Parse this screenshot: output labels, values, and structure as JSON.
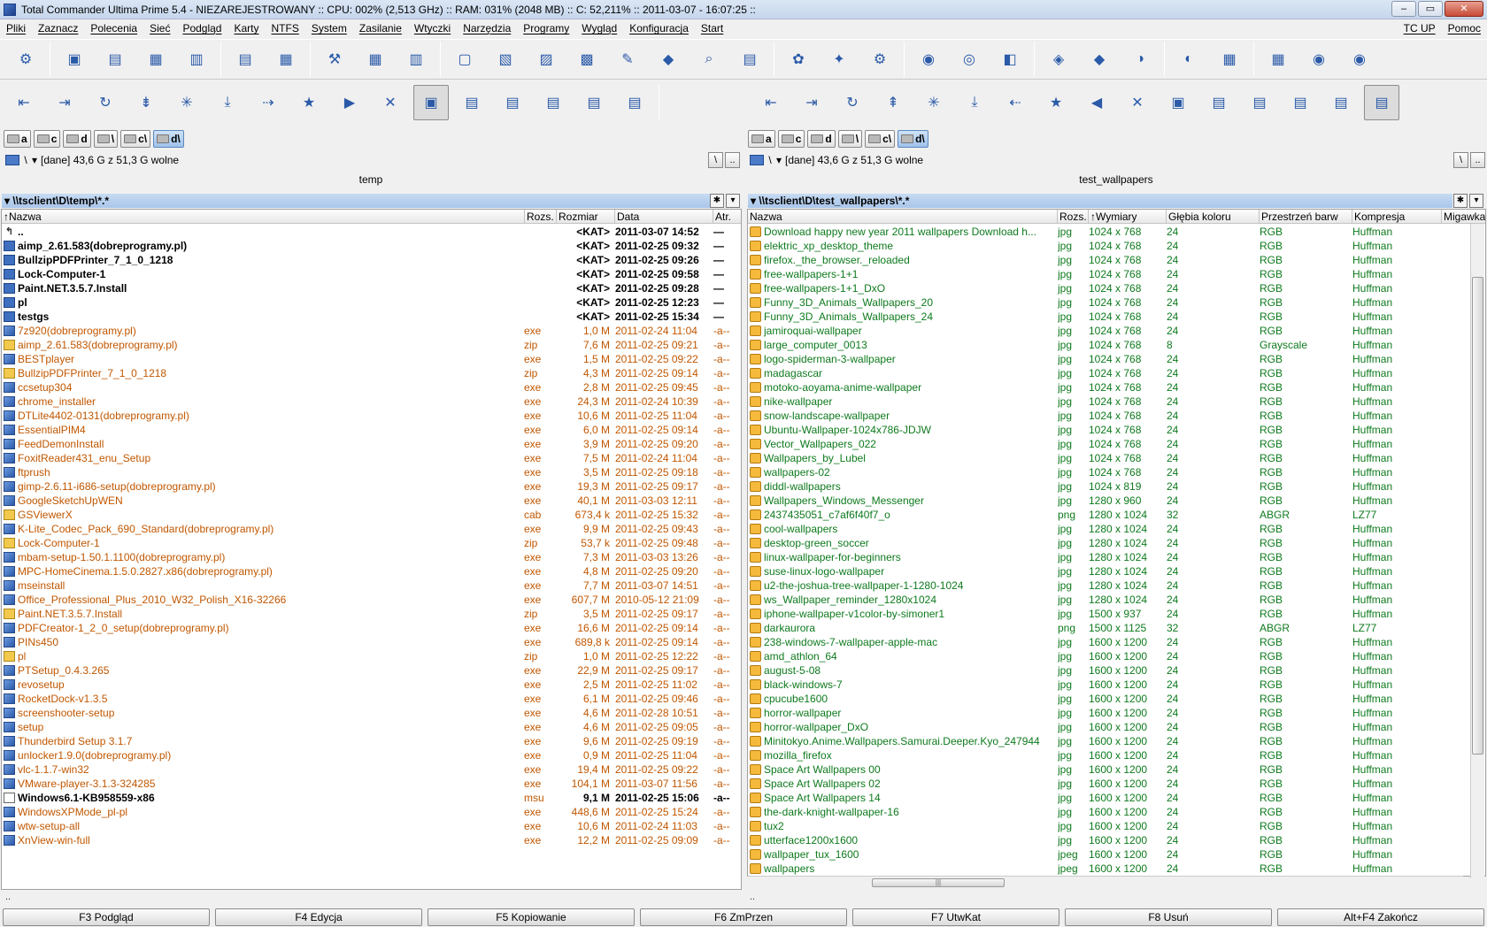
{
  "window": {
    "title": "Total Commander Ultima Prime 5.4 - NIEZAREJESTROWANY :: CPU: 002% (2,513 GHz) :: RAM: 031% (2048 MB) :: C: 52,211% :: 2011-03-07 - 16:07:25 ::",
    "minimize": "–",
    "maximize": "▭",
    "close": "✕"
  },
  "menu": {
    "items": [
      "Pliki",
      "Zaznacz",
      "Polecenia",
      "Sieć",
      "Podgląd",
      "Karty",
      "NTFS",
      "System",
      "Zasilanie",
      "Wtyczki",
      "Narzędzia",
      "Programy",
      "Wygląd",
      "Konfiguracja",
      "Start"
    ],
    "right": [
      "TC UP",
      "Pomoc"
    ]
  },
  "toolbar": {
    "icons": [
      "⚙",
      "▣",
      "▤",
      "▦",
      "▥",
      "▤",
      "▦",
      "⚒",
      "▦",
      "▥",
      "▢",
      "▧",
      "▨",
      "▩",
      "✎",
      "◆",
      "⌕",
      "▤",
      "✿",
      "✦",
      "⚙",
      "◉",
      "◎",
      "◧",
      "◈",
      "◆",
      "◑",
      "◐",
      "▦",
      "▦",
      "◉",
      "◉"
    ]
  },
  "left": {
    "nav_icons": [
      "⇤",
      "⇥",
      "↻",
      "⇟",
      "✳",
      "⤓",
      "⇢",
      "★",
      "▶",
      "✕",
      "▣",
      "▤",
      "▤",
      "▤",
      "▤",
      "▤"
    ],
    "drives": [
      "a",
      "c",
      "d",
      "\\",
      "c\\",
      "d\\"
    ],
    "path_combo": "\\",
    "free_space": "[dane]  43,6 G z 51,3 G wolne",
    "root_btn": "\\",
    "up_btn": "..",
    "title": "temp",
    "path": "\\\\tsclient\\D\\temp\\*.*",
    "columns": {
      "name": "Nazwa",
      "ext": "Rozs.",
      "size": "Rozmiar",
      "date": "Data",
      "attr": "Atr."
    },
    "files": [
      {
        "name": "..",
        "ext": "",
        "size": "<KAT>",
        "date": "2011-03-07 14:52",
        "attr": "—",
        "type": "up"
      },
      {
        "name": "aimp_2.61.583(dobreprogramy.pl)",
        "ext": "",
        "size": "<KAT>",
        "date": "2011-02-25 09:32",
        "attr": "—",
        "type": "dir"
      },
      {
        "name": "BullzipPDFPrinter_7_1_0_1218",
        "ext": "",
        "size": "<KAT>",
        "date": "2011-02-25 09:26",
        "attr": "—",
        "type": "dir"
      },
      {
        "name": "Lock-Computer-1",
        "ext": "",
        "size": "<KAT>",
        "date": "2011-02-25 09:58",
        "attr": "—",
        "type": "dir"
      },
      {
        "name": "Paint.NET.3.5.7.Install",
        "ext": "",
        "size": "<KAT>",
        "date": "2011-02-25 09:28",
        "attr": "—",
        "type": "dir"
      },
      {
        "name": "pl",
        "ext": "",
        "size": "<KAT>",
        "date": "2011-02-25 12:23",
        "attr": "—",
        "type": "dir"
      },
      {
        "name": "testgs",
        "ext": "",
        "size": "<KAT>",
        "date": "2011-02-25 15:34",
        "attr": "—",
        "type": "dir"
      },
      {
        "name": "7z920(dobreprogramy.pl)",
        "ext": "exe",
        "size": "1,0 M",
        "date": "2011-02-24 11:04",
        "attr": "-a--",
        "type": "exe"
      },
      {
        "name": "aimp_2.61.583(dobreprogramy.pl)",
        "ext": "zip",
        "size": "7,6 M",
        "date": "2011-02-25 09:21",
        "attr": "-a--",
        "type": "zip"
      },
      {
        "name": "BESTplayer",
        "ext": "exe",
        "size": "1,5 M",
        "date": "2011-02-25 09:22",
        "attr": "-a--",
        "type": "exe"
      },
      {
        "name": "BullzipPDFPrinter_7_1_0_1218",
        "ext": "zip",
        "size": "4,3 M",
        "date": "2011-02-25 09:14",
        "attr": "-a--",
        "type": "zip"
      },
      {
        "name": "ccsetup304",
        "ext": "exe",
        "size": "2,8 M",
        "date": "2011-02-25 09:45",
        "attr": "-a--",
        "type": "exe"
      },
      {
        "name": "chrome_installer",
        "ext": "exe",
        "size": "24,3 M",
        "date": "2011-02-24 10:39",
        "attr": "-a--",
        "type": "exe"
      },
      {
        "name": "DTLite4402-0131(dobreprogramy.pl)",
        "ext": "exe",
        "size": "10,6 M",
        "date": "2011-02-25 11:04",
        "attr": "-a--",
        "type": "exe"
      },
      {
        "name": "EssentialPIM4",
        "ext": "exe",
        "size": "6,0 M",
        "date": "2011-02-25 09:14",
        "attr": "-a--",
        "type": "exe"
      },
      {
        "name": "FeedDemonInstall",
        "ext": "exe",
        "size": "3,9 M",
        "date": "2011-02-25 09:20",
        "attr": "-a--",
        "type": "exe"
      },
      {
        "name": "FoxitReader431_enu_Setup",
        "ext": "exe",
        "size": "7,5 M",
        "date": "2011-02-24 11:04",
        "attr": "-a--",
        "type": "exe"
      },
      {
        "name": "ftprush",
        "ext": "exe",
        "size": "3,5 M",
        "date": "2011-02-25 09:18",
        "attr": "-a--",
        "type": "exe"
      },
      {
        "name": "gimp-2.6.11-i686-setup(dobreprogramy.pl)",
        "ext": "exe",
        "size": "19,3 M",
        "date": "2011-02-25 09:17",
        "attr": "-a--",
        "type": "exe"
      },
      {
        "name": "GoogleSketchUpWEN",
        "ext": "exe",
        "size": "40,1 M",
        "date": "2011-03-03 12:11",
        "attr": "-a--",
        "type": "exe"
      },
      {
        "name": "GSViewerX",
        "ext": "cab",
        "size": "673,4 k",
        "date": "2011-02-25 15:32",
        "attr": "-a--",
        "type": "zip"
      },
      {
        "name": "K-Lite_Codec_Pack_690_Standard(dobreprogramy.pl)",
        "ext": "exe",
        "size": "9,9 M",
        "date": "2011-02-25 09:43",
        "attr": "-a--",
        "type": "exe"
      },
      {
        "name": "Lock-Computer-1",
        "ext": "zip",
        "size": "53,7 k",
        "date": "2011-02-25 09:48",
        "attr": "-a--",
        "type": "zip"
      },
      {
        "name": "mbam-setup-1.50.1.1100(dobreprogramy.pl)",
        "ext": "exe",
        "size": "7,3 M",
        "date": "2011-03-03 13:26",
        "attr": "-a--",
        "type": "exe"
      },
      {
        "name": "MPC-HomeCinema.1.5.0.2827.x86(dobreprogramy.pl)",
        "ext": "exe",
        "size": "4,8 M",
        "date": "2011-02-25 09:20",
        "attr": "-a--",
        "type": "exe"
      },
      {
        "name": "mseinstall",
        "ext": "exe",
        "size": "7,7 M",
        "date": "2011-03-07 14:51",
        "attr": "-a--",
        "type": "exe"
      },
      {
        "name": "Office_Professional_Plus_2010_W32_Polish_X16-32266",
        "ext": "exe",
        "size": "607,7 M",
        "date": "2010-05-12 21:09",
        "attr": "-a--",
        "type": "exe"
      },
      {
        "name": "Paint.NET.3.5.7.Install",
        "ext": "zip",
        "size": "3,5 M",
        "date": "2011-02-25 09:17",
        "attr": "-a--",
        "type": "zip"
      },
      {
        "name": "PDFCreator-1_2_0_setup(dobreprogramy.pl)",
        "ext": "exe",
        "size": "16,6 M",
        "date": "2011-02-25 09:14",
        "attr": "-a--",
        "type": "exe"
      },
      {
        "name": "PINs450",
        "ext": "exe",
        "size": "689,8 k",
        "date": "2011-02-25 09:14",
        "attr": "-a--",
        "type": "exe"
      },
      {
        "name": "pl",
        "ext": "zip",
        "size": "1,0 M",
        "date": "2011-02-25 12:22",
        "attr": "-a--",
        "type": "zip"
      },
      {
        "name": "PTSetup_0.4.3.265",
        "ext": "exe",
        "size": "22,9 M",
        "date": "2011-02-25 09:17",
        "attr": "-a--",
        "type": "exe"
      },
      {
        "name": "revosetup",
        "ext": "exe",
        "size": "2,5 M",
        "date": "2011-02-25 11:02",
        "attr": "-a--",
        "type": "exe"
      },
      {
        "name": "RocketDock-v1.3.5",
        "ext": "exe",
        "size": "6,1 M",
        "date": "2011-02-25 09:46",
        "attr": "-a--",
        "type": "exe"
      },
      {
        "name": "screenshooter-setup",
        "ext": "exe",
        "size": "4,6 M",
        "date": "2011-02-28 10:51",
        "attr": "-a--",
        "type": "exe"
      },
      {
        "name": "setup",
        "ext": "exe",
        "size": "4,6 M",
        "date": "2011-02-25 09:05",
        "attr": "-a--",
        "type": "exe"
      },
      {
        "name": "Thunderbird Setup 3.1.7",
        "ext": "exe",
        "size": "9,6 M",
        "date": "2011-02-25 09:19",
        "attr": "-a--",
        "type": "exe"
      },
      {
        "name": "unlocker1.9.0(dobreprogramy.pl)",
        "ext": "exe",
        "size": "0,9 M",
        "date": "2011-02-25 11:04",
        "attr": "-a--",
        "type": "exe"
      },
      {
        "name": "vlc-1.1.7-win32",
        "ext": "exe",
        "size": "19,4 M",
        "date": "2011-02-25 09:22",
        "attr": "-a--",
        "type": "exe"
      },
      {
        "name": "VMware-player-3.1.3-324285",
        "ext": "exe",
        "size": "104,1 M",
        "date": "2011-03-07 11:56",
        "attr": "-a--",
        "type": "exe"
      },
      {
        "name": "Windows6.1-KB958559-x86",
        "ext": "msu",
        "size": "9,1 M",
        "date": "2011-02-25 15:06",
        "attr": "-a--",
        "type": "msu"
      },
      {
        "name": "WindowsXPMode_pl-pl",
        "ext": "exe",
        "size": "448,6 M",
        "date": "2011-02-25 15:24",
        "attr": "-a--",
        "type": "exe"
      },
      {
        "name": "wtw-setup-all",
        "ext": "exe",
        "size": "10,6 M",
        "date": "2011-02-24 11:03",
        "attr": "-a--",
        "type": "exe"
      },
      {
        "name": "XnView-win-full",
        "ext": "exe",
        "size": "12,2 M",
        "date": "2011-02-25 09:09",
        "attr": "-a--",
        "type": "exe"
      }
    ]
  },
  "right": {
    "nav_icons": [
      "⇤",
      "⇥",
      "↻",
      "⇞",
      "✳",
      "⤓",
      "⇠",
      "★",
      "◀",
      "✕",
      "▣",
      "▤",
      "▤",
      "▤",
      "▤",
      "▤"
    ],
    "drives": [
      "a",
      "c",
      "d",
      "\\",
      "c\\",
      "d\\"
    ],
    "path_combo": "\\",
    "free_space": "[dane]  43,6 G z 51,3 G wolne",
    "root_btn": "\\",
    "up_btn": "..",
    "title": "test_wallpapers",
    "path": "\\\\tsclient\\D\\test_wallpapers\\*.*",
    "columns": {
      "name": "Nazwa",
      "ext": "Rozs.",
      "dim": "Wymiary",
      "depth": "Głębia koloru",
      "space": "Przestrzeń barw",
      "comp": "Kompresja",
      "shutter": "Migawka"
    },
    "files": [
      {
        "name": "Download happy new year 2011 wallpapers Download h...",
        "ext": "jpg",
        "dim": "1024 x 768",
        "depth": "24",
        "space": "RGB",
        "comp": "Huffman"
      },
      {
        "name": "elektric_xp_desktop_theme",
        "ext": "jpg",
        "dim": "1024 x 768",
        "depth": "24",
        "space": "RGB",
        "comp": "Huffman"
      },
      {
        "name": "firefox._the_browser._reloaded",
        "ext": "jpg",
        "dim": "1024 x 768",
        "depth": "24",
        "space": "RGB",
        "comp": "Huffman"
      },
      {
        "name": "free-wallpapers-1+1",
        "ext": "jpg",
        "dim": "1024 x 768",
        "depth": "24",
        "space": "RGB",
        "comp": "Huffman"
      },
      {
        "name": "free-wallpapers-1+1_DxO",
        "ext": "jpg",
        "dim": "1024 x 768",
        "depth": "24",
        "space": "RGB",
        "comp": "Huffman"
      },
      {
        "name": "Funny_3D_Animals_Wallpapers_20",
        "ext": "jpg",
        "dim": "1024 x 768",
        "depth": "24",
        "space": "RGB",
        "comp": "Huffman"
      },
      {
        "name": "Funny_3D_Animals_Wallpapers_24",
        "ext": "jpg",
        "dim": "1024 x 768",
        "depth": "24",
        "space": "RGB",
        "comp": "Huffman"
      },
      {
        "name": "jamiroquai-wallpaper",
        "ext": "jpg",
        "dim": "1024 x 768",
        "depth": "24",
        "space": "RGB",
        "comp": "Huffman"
      },
      {
        "name": "large_computer_0013",
        "ext": "jpg",
        "dim": "1024 x 768",
        "depth": "8",
        "space": "Grayscale",
        "comp": "Huffman"
      },
      {
        "name": "logo-spiderman-3-wallpaper",
        "ext": "jpg",
        "dim": "1024 x 768",
        "depth": "24",
        "space": "RGB",
        "comp": "Huffman"
      },
      {
        "name": "madagascar",
        "ext": "jpg",
        "dim": "1024 x 768",
        "depth": "24",
        "space": "RGB",
        "comp": "Huffman"
      },
      {
        "name": "motoko-aoyama-anime-wallpaper",
        "ext": "jpg",
        "dim": "1024 x 768",
        "depth": "24",
        "space": "RGB",
        "comp": "Huffman"
      },
      {
        "name": "nike-wallpaper",
        "ext": "jpg",
        "dim": "1024 x 768",
        "depth": "24",
        "space": "RGB",
        "comp": "Huffman"
      },
      {
        "name": "snow-landscape-wallpaper",
        "ext": "jpg",
        "dim": "1024 x 768",
        "depth": "24",
        "space": "RGB",
        "comp": "Huffman"
      },
      {
        "name": "Ubuntu-Wallpaper-1024x786-JDJW",
        "ext": "jpg",
        "dim": "1024 x 768",
        "depth": "24",
        "space": "RGB",
        "comp": "Huffman"
      },
      {
        "name": "Vector_Wallpapers_022",
        "ext": "jpg",
        "dim": "1024 x 768",
        "depth": "24",
        "space": "RGB",
        "comp": "Huffman"
      },
      {
        "name": "Wallpapers_by_Lubel",
        "ext": "jpg",
        "dim": "1024 x 768",
        "depth": "24",
        "space": "RGB",
        "comp": "Huffman"
      },
      {
        "name": "wallpapers-02",
        "ext": "jpg",
        "dim": "1024 x 768",
        "depth": "24",
        "space": "RGB",
        "comp": "Huffman"
      },
      {
        "name": "diddl-wallpapers",
        "ext": "jpg",
        "dim": "1024 x 819",
        "depth": "24",
        "space": "RGB",
        "comp": "Huffman"
      },
      {
        "name": "Wallpapers_Windows_Messenger",
        "ext": "jpg",
        "dim": "1280 x 960",
        "depth": "24",
        "space": "RGB",
        "comp": "Huffman"
      },
      {
        "name": "2437435051_c7af6f40f7_o",
        "ext": "png",
        "dim": "1280 x 1024",
        "depth": "32",
        "space": "ABGR",
        "comp": "LZ77"
      },
      {
        "name": "cool-wallpapers",
        "ext": "jpg",
        "dim": "1280 x 1024",
        "depth": "24",
        "space": "RGB",
        "comp": "Huffman"
      },
      {
        "name": "desktop-green_soccer",
        "ext": "jpg",
        "dim": "1280 x 1024",
        "depth": "24",
        "space": "RGB",
        "comp": "Huffman"
      },
      {
        "name": "linux-wallpaper-for-beginners",
        "ext": "jpg",
        "dim": "1280 x 1024",
        "depth": "24",
        "space": "RGB",
        "comp": "Huffman"
      },
      {
        "name": "suse-linux-logo-wallpaper",
        "ext": "jpg",
        "dim": "1280 x 1024",
        "depth": "24",
        "space": "RGB",
        "comp": "Huffman"
      },
      {
        "name": "u2-the-joshua-tree-wallpaper-1-1280-1024",
        "ext": "jpg",
        "dim": "1280 x 1024",
        "depth": "24",
        "space": "RGB",
        "comp": "Huffman"
      },
      {
        "name": "ws_Wallpaper_reminder_1280x1024",
        "ext": "jpg",
        "dim": "1280 x 1024",
        "depth": "24",
        "space": "RGB",
        "comp": "Huffman"
      },
      {
        "name": "iphone-wallpaper-v1color-by-simoner1",
        "ext": "jpg",
        "dim": "1500 x 937",
        "depth": "24",
        "space": "RGB",
        "comp": "Huffman"
      },
      {
        "name": "darkaurora",
        "ext": "png",
        "dim": "1500 x 1125",
        "depth": "32",
        "space": "ABGR",
        "comp": "LZ77"
      },
      {
        "name": "238-windows-7-wallpaper-apple-mac",
        "ext": "jpg",
        "dim": "1600 x 1200",
        "depth": "24",
        "space": "RGB",
        "comp": "Huffman"
      },
      {
        "name": "amd_athlon_64",
        "ext": "jpg",
        "dim": "1600 x 1200",
        "depth": "24",
        "space": "RGB",
        "comp": "Huffman"
      },
      {
        "name": "august-5-08",
        "ext": "jpg",
        "dim": "1600 x 1200",
        "depth": "24",
        "space": "RGB",
        "comp": "Huffman"
      },
      {
        "name": "black-windows-7",
        "ext": "jpg",
        "dim": "1600 x 1200",
        "depth": "24",
        "space": "RGB",
        "comp": "Huffman"
      },
      {
        "name": "cpucube1600",
        "ext": "jpg",
        "dim": "1600 x 1200",
        "depth": "24",
        "space": "RGB",
        "comp": "Huffman"
      },
      {
        "name": "horror-wallpaper",
        "ext": "jpg",
        "dim": "1600 x 1200",
        "depth": "24",
        "space": "RGB",
        "comp": "Huffman"
      },
      {
        "name": "horror-wallpaper_DxO",
        "ext": "jpg",
        "dim": "1600 x 1200",
        "depth": "24",
        "space": "RGB",
        "comp": "Huffman"
      },
      {
        "name": "Minitokyo.Anime.Wallpapers.Samurai.Deeper.Kyo_247944",
        "ext": "jpg",
        "dim": "1600 x 1200",
        "depth": "24",
        "space": "RGB",
        "comp": "Huffman"
      },
      {
        "name": "mozilla_firefox",
        "ext": "jpg",
        "dim": "1600 x 1200",
        "depth": "24",
        "space": "RGB",
        "comp": "Huffman"
      },
      {
        "name": "Space Art Wallpapers 00",
        "ext": "jpg",
        "dim": "1600 x 1200",
        "depth": "24",
        "space": "RGB",
        "comp": "Huffman"
      },
      {
        "name": "Space Art Wallpapers 02",
        "ext": "jpg",
        "dim": "1600 x 1200",
        "depth": "24",
        "space": "RGB",
        "comp": "Huffman"
      },
      {
        "name": "Space Art Wallpapers 14",
        "ext": "jpg",
        "dim": "1600 x 1200",
        "depth": "24",
        "space": "RGB",
        "comp": "Huffman"
      },
      {
        "name": "the-dark-knight-wallpaper-16",
        "ext": "jpg",
        "dim": "1600 x 1200",
        "depth": "24",
        "space": "RGB",
        "comp": "Huffman"
      },
      {
        "name": "tux2",
        "ext": "jpg",
        "dim": "1600 x 1200",
        "depth": "24",
        "space": "RGB",
        "comp": "Huffman"
      },
      {
        "name": "utterface1200x1600",
        "ext": "jpg",
        "dim": "1600 x 1200",
        "depth": "24",
        "space": "RGB",
        "comp": "Huffman"
      },
      {
        "name": "wallpaper_tux_1600",
        "ext": "jpeg",
        "dim": "1600 x 1200",
        "depth": "24",
        "space": "RGB",
        "comp": "Huffman"
      },
      {
        "name": "wallpapers",
        "ext": "jpeg",
        "dim": "1600 x 1200",
        "depth": "24",
        "space": "RGB",
        "comp": "Huffman"
      }
    ]
  },
  "cmdline": "..",
  "fkeys": [
    "F3 Podgląd",
    "F4 Edycja",
    "F5 Kopiowanie",
    "F6 ZmPrzen",
    "F7 UtwKat",
    "F8 Usuń",
    "Alt+F4 Zakończ"
  ],
  "colors": {
    "dir_text": "#000000",
    "exe_text": "#c15700",
    "img_text": "#0e7a1d",
    "path_bar": "#b7d0ef"
  }
}
